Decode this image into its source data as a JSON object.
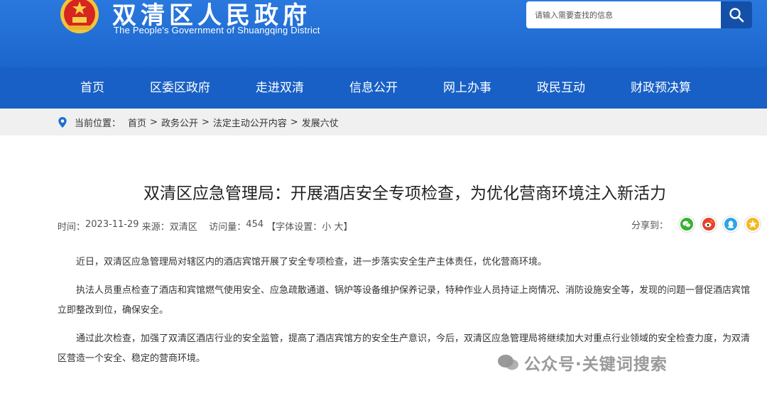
{
  "header": {
    "title": "双清区人民政府",
    "subtitle": "The People's Government of Shuangqing District",
    "search_placeholder": "请输入需要查找的信息",
    "colors": {
      "primary": "#1f6fd6",
      "nav": "#1860c6",
      "search_button": "#1450a8"
    }
  },
  "nav": {
    "items": [
      {
        "label": "首页"
      },
      {
        "label": "区委区政府"
      },
      {
        "label": "走进双清"
      },
      {
        "label": "信息公开"
      },
      {
        "label": "网上办事"
      },
      {
        "label": "政民互动"
      },
      {
        "label": "财政预决算"
      }
    ]
  },
  "breadcrumb": {
    "prefix": "当前位置：",
    "items": [
      "首页",
      "政务公开",
      "法定主动公开内容",
      "发展六仗"
    ],
    "separator": ">"
  },
  "article": {
    "title": "双清区应急管理局：开展酒店安全专项检查，为优化营商环境注入新活力",
    "meta": {
      "time_label": "时间：",
      "time": "2023-11-29",
      "source_label": "来源：",
      "source": "双清区",
      "views_label": "访问量：",
      "views": "454",
      "font_label": "【字体设置：",
      "font_small": "小",
      "font_large": "大",
      "font_end": "】"
    },
    "share_label": "分享到：",
    "paragraphs": [
      "近日，双清区应急管理局对辖区内的酒店宾馆开展了安全专项检查，进一步落实安全生产主体责任，优化营商环境。",
      "执法人员重点检查了酒店和宾馆燃气使用安全、应急疏散通道、锅炉等设备维护保养记录，特种作业人员持证上岗情况、消防设施安全等，发现的问题一督促酒店宾馆立即整改到位，确保安全。",
      "通过此次检查，加强了双清区酒店行业的安全监管，提高了酒店宾馆方的安全生产意识，今后，双清区应急管理局将继续加大对重点行业领域的安全检查力度，为双清区营造一个安全、稳定的营商环境。"
    ]
  },
  "watermark": {
    "text": "公众号·关键词搜索"
  }
}
